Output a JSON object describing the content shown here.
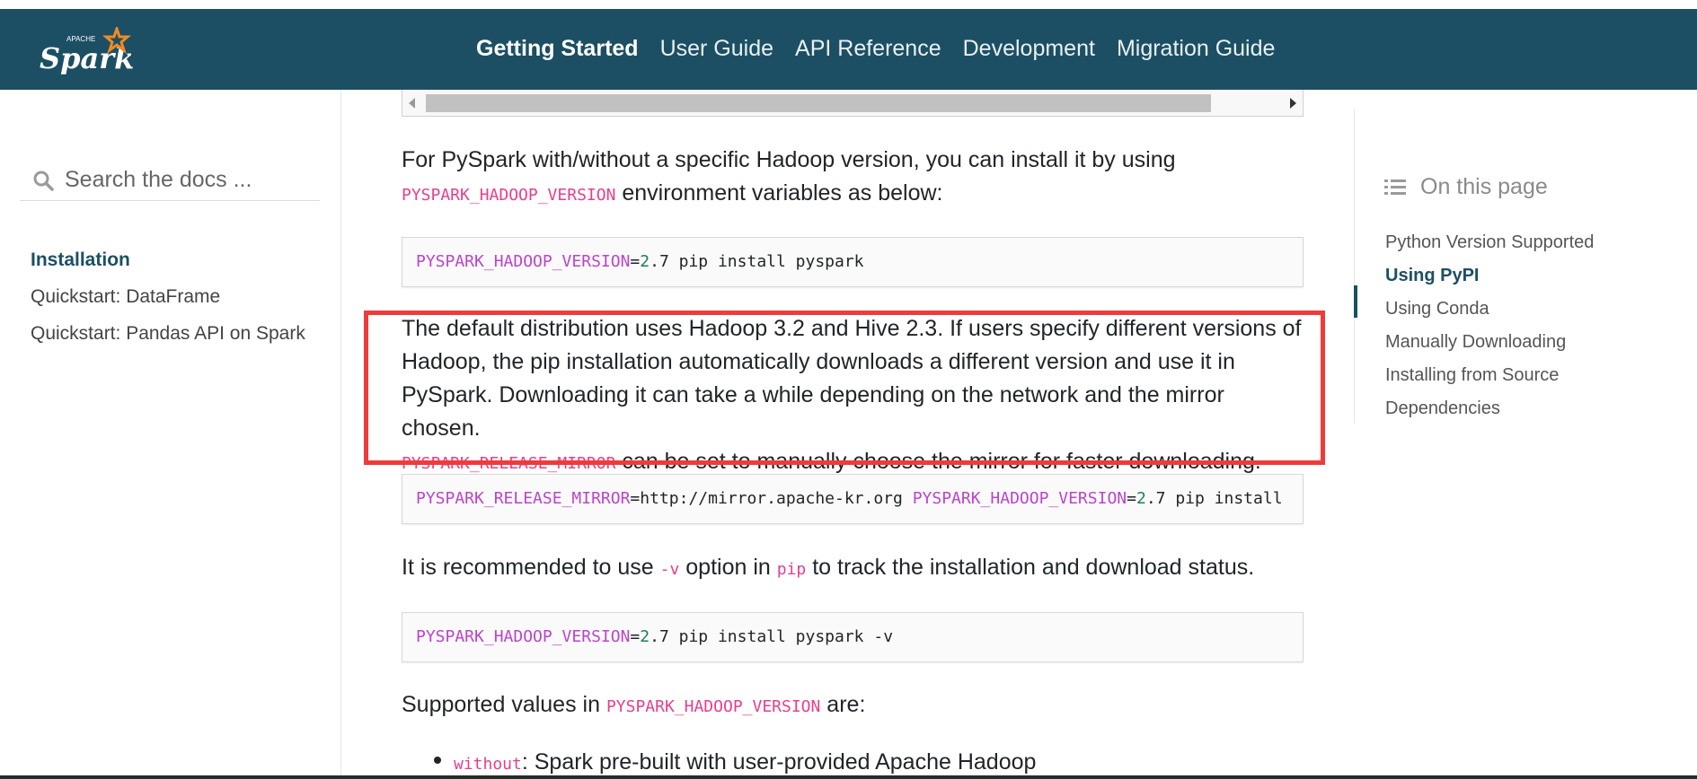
{
  "brand": {
    "logo_word": "Spark",
    "logo_super": "APACHE"
  },
  "nav": {
    "items": [
      {
        "label": "Getting Started",
        "active": true
      },
      {
        "label": "User Guide",
        "active": false
      },
      {
        "label": "API Reference",
        "active": false
      },
      {
        "label": "Development",
        "active": false
      },
      {
        "label": "Migration Guide",
        "active": false
      }
    ]
  },
  "search": {
    "placeholder": "Search the docs ..."
  },
  "sidebar": {
    "items": [
      {
        "label": "Installation",
        "active": true
      },
      {
        "label": "Quickstart: DataFrame",
        "active": false
      },
      {
        "label": "Quickstart: Pandas API on Spark",
        "active": false
      }
    ]
  },
  "content": {
    "p1": {
      "text_a": "For PySpark with/without a specific Hadoop version, you can install it by using",
      "code": "PYSPARK_HADOOP_VERSION",
      "text_b": " environment variables as below:"
    },
    "code1": {
      "var": "PYSPARK_HADOOP_VERSION",
      "eq": "=",
      "num": "2",
      "rest": ".7 pip install pyspark"
    },
    "p2": {
      "line1": "The default distribution uses Hadoop 3.2 and Hive 2.3. If users specify different versions of",
      "line2": "Hadoop, the pip installation automatically downloads a different version and use it in",
      "line3": "PySpark. Downloading it can take a while depending on the network and the mirror chosen.",
      "code": "PYSPARK_RELEASE_MIRROR",
      "text_b": " can be set to manually choose the mirror for faster downloading."
    },
    "code2": {
      "var1": "PYSPARK_RELEASE_MIRROR",
      "mid": "=http://mirror.apache-kr.org ",
      "var2": "PYSPARK_HADOOP_VERSION",
      "eq": "=",
      "num": "2",
      "rest": ".7 pip install"
    },
    "p3": {
      "text_a": "It is recommended to use ",
      "code1": "-v",
      "text_b": " option in ",
      "code2": "pip",
      "text_c": " to track the installation and download status."
    },
    "code3": {
      "var": "PYSPARK_HADOOP_VERSION",
      "eq": "=",
      "num": "2",
      "rest": ".7 pip install pyspark -v"
    },
    "p4": {
      "text_a": "Supported values in ",
      "code": "PYSPARK_HADOOP_VERSION",
      "text_b": " are:"
    },
    "bullet1": {
      "code": "without",
      "text": ": Spark pre-built with user-provided Apache Hadoop"
    }
  },
  "toc": {
    "header": "On this page",
    "items": [
      {
        "label": "Python Version Supported",
        "active": false
      },
      {
        "label": "Using PyPI",
        "active": true
      },
      {
        "label": "Using Conda",
        "active": false
      },
      {
        "label": "Manually Downloading",
        "active": false
      },
      {
        "label": "Installing from Source",
        "active": false
      },
      {
        "label": "Dependencies",
        "active": false
      }
    ]
  },
  "colors": {
    "navbar_bg": "#1c4f63",
    "highlight_border": "#ee3b3b",
    "inline_code": "#e83e8c",
    "logo_star": "#f08a24"
  }
}
